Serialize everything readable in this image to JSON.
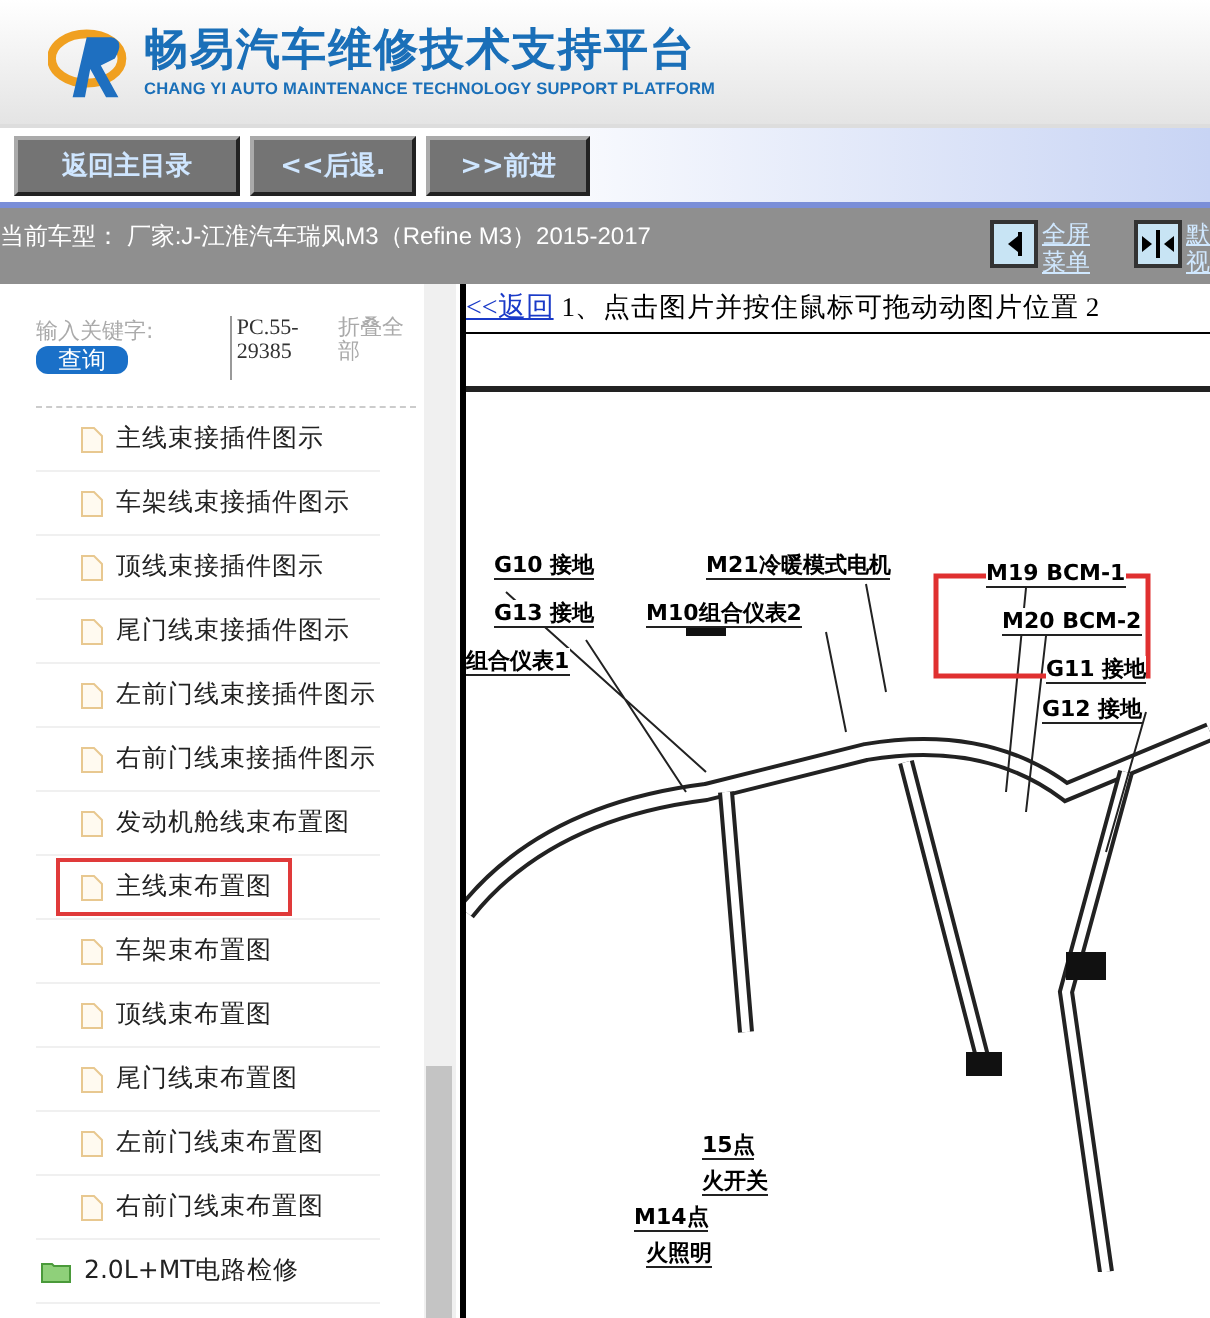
{
  "header": {
    "title": "畅易汽车维修技术支持平台",
    "subtitle": "CHANG YI AUTO MAINTENANCE TECHNOLOGY SUPPORT PLATFORM"
  },
  "toolbar": {
    "buttons": [
      "返回主目录",
      "<<后退.",
      ">>前进"
    ]
  },
  "info_bar": {
    "car_model": "当前车型： 厂家:J-江淮汽车瑞风M3（Refine M3）2015-2017",
    "actions": [
      {
        "kind": "fullscreen",
        "label_lines": [
          "全屏",
          "菜单"
        ]
      },
      {
        "kind": "default",
        "label_lines": [
          "默",
          "视"
        ]
      }
    ]
  },
  "sidebar": {
    "search_label": "输入关键字:",
    "search_button": "查询",
    "search_value": "PC.55-29385",
    "collapse_link": "折叠全部",
    "items": [
      {
        "label": "主线束接插件图示",
        "kind": "file",
        "selected": false
      },
      {
        "label": "车架线束接插件图示",
        "kind": "file",
        "selected": false
      },
      {
        "label": "顶线束接插件图示",
        "kind": "file",
        "selected": false
      },
      {
        "label": "尾门线束接插件图示",
        "kind": "file",
        "selected": false
      },
      {
        "label": "左前门线束接插件图示",
        "kind": "file",
        "selected": false
      },
      {
        "label": "右前门线束接插件图示",
        "kind": "file",
        "selected": false
      },
      {
        "label": "发动机舱线束布置图",
        "kind": "file",
        "selected": false
      },
      {
        "label": "主线束布置图",
        "kind": "file",
        "selected": true
      },
      {
        "label": "车架束布置图",
        "kind": "file",
        "selected": false
      },
      {
        "label": "顶线束布置图",
        "kind": "file",
        "selected": false
      },
      {
        "label": "尾门线束布置图",
        "kind": "file",
        "selected": false
      },
      {
        "label": "左前门线束布置图",
        "kind": "file",
        "selected": false
      },
      {
        "label": "右前门线束布置图",
        "kind": "file",
        "selected": false
      },
      {
        "label": "2.0L+MT电路检修",
        "kind": "folder",
        "selected": false
      }
    ]
  },
  "content": {
    "back_link": "<<返回",
    "instruction": "1、点击图片并按住鼠标可拖动动图片位置 2",
    "diagram_labels": [
      "G10 接地",
      "G13 接地",
      "组合仪表1",
      "M21冷暖模式电机",
      "M10组合仪表2",
      "M19 BCM-1",
      "M20 BCM-2",
      "G11 接地",
      "G12 接地",
      "15点",
      "火开关",
      "M14点",
      "火照明"
    ]
  }
}
